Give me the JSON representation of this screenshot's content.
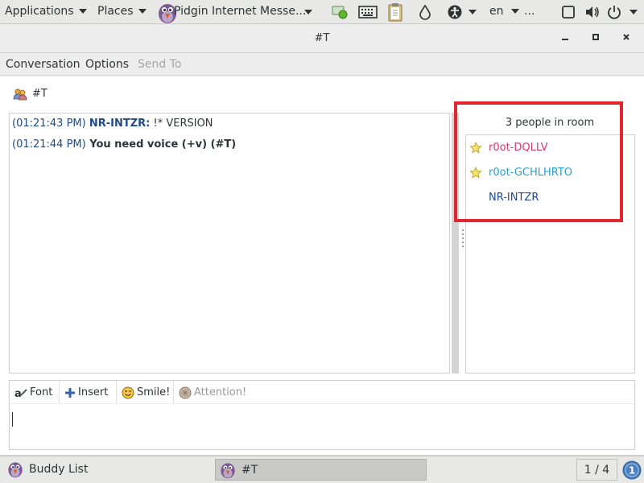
{
  "top_panel": {
    "applications": "Applications",
    "places": "Places",
    "active_app": "Pidgin Internet Messe...",
    "language": "en",
    "overflow": "..."
  },
  "window": {
    "title": "#T",
    "minimize": "×",
    "menus": [
      "Conversation",
      "Options",
      "Send To"
    ]
  },
  "conversation": {
    "room_name": "#T",
    "messages": [
      {
        "time": "(01:21:43 PM)",
        "sender": "NR-INTZR:",
        "text": " !* VERSION"
      },
      {
        "time": "(01:21:44 PM)",
        "text": " You need voice (+v) (#T)"
      }
    ]
  },
  "people": {
    "count_label": "3 people in room",
    "members": [
      {
        "name": "r0ot-DQLLV",
        "color": "#d6386c",
        "voiced": true
      },
      {
        "name": "r0ot-GCHLHRTO",
        "color": "#2a9fc9",
        "voiced": true
      },
      {
        "name": "NR-INTZR",
        "color": "#204a87",
        "voiced": false
      }
    ]
  },
  "toolbar": {
    "font_label": "Font",
    "insert_label": "Insert",
    "smile_label": "Smile!",
    "attention_label": "Attention!"
  },
  "taskbar": {
    "buddy_list": "Buddy List",
    "chat": "#T",
    "pager": "1 / 4",
    "notifications": "1"
  },
  "colors": {
    "highlight": "#e3262e",
    "link_blue": "#204a87"
  }
}
